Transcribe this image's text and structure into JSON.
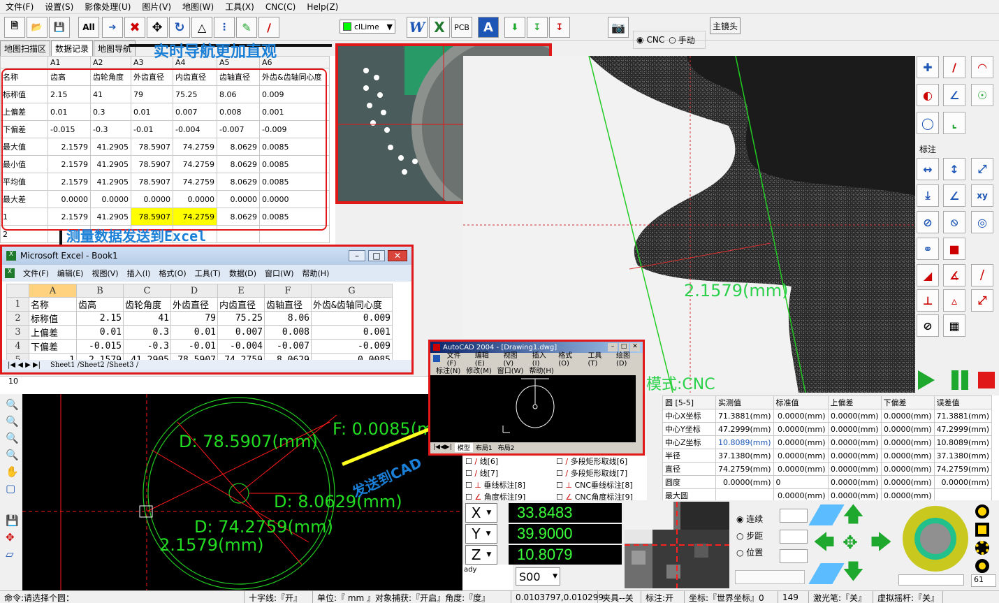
{
  "menu": [
    "文件(F)",
    "设置(S)",
    "影像处理(U)",
    "图片(V)",
    "地图(W)",
    "工具(X)",
    "CNC(C)",
    "Help(Z)"
  ],
  "toolbar": {
    "all_label": "All",
    "color_value": "clLime",
    "pcb_label": "PCB",
    "mode_cnc": "CNC",
    "mode_manual": "手动",
    "main_lens": "主镜头"
  },
  "tabs": [
    "地图扫描区",
    "数据记录",
    "地图导航"
  ],
  "ann": {
    "nav": "实时导航更加直观",
    "excel": "测量数据发送到Excel",
    "cad": "发送到CAD",
    "mode": "模式:CNC",
    "meas": "2.1579(mm)"
  },
  "grid": {
    "cols": [
      "",
      "A1",
      "A2",
      "A3",
      "A4",
      "A5",
      "A6"
    ],
    "rows": [
      [
        "名称",
        "齿高",
        "齿轮角度",
        "外齿直径",
        "内齿直径",
        "齿轴直径",
        "外齿&齿轴同心度"
      ],
      [
        "标称值",
        "2.15",
        "41",
        "79",
        "75.25",
        "8.06",
        "0.009"
      ],
      [
        "上偏差",
        "0.01",
        "0.3",
        "0.01",
        "0.007",
        "0.008",
        "0.001"
      ],
      [
        "下偏差",
        "-0.015",
        "-0.3",
        "-0.01",
        "-0.004",
        "-0.007",
        "-0.009"
      ],
      [
        "最大值",
        "2.1579",
        "41.2905",
        "78.5907",
        "74.2759",
        "8.0629",
        "0.0085"
      ],
      [
        "最小值",
        "2.1579",
        "41.2905",
        "78.5907",
        "74.2759",
        "8.0629",
        "0.0085"
      ],
      [
        "平均值",
        "2.1579",
        "41.2905",
        "78.5907",
        "74.2759",
        "8.0629",
        "0.0085"
      ],
      [
        "最大差",
        "0.0000",
        "0.0000",
        "0.0000",
        "0.0000",
        "0.0000",
        "0.0000"
      ],
      [
        "1",
        "2.1579",
        "41.2905",
        "78.5907",
        "74.2759",
        "8.0629",
        "0.0085"
      ],
      [
        "2",
        "",
        "",
        "",
        "",
        "",
        ""
      ]
    ]
  },
  "excel": {
    "title": "Microsoft Excel - Book1",
    "menu": [
      "文件(F)",
      "编辑(E)",
      "视图(V)",
      "插入(I)",
      "格式(O)",
      "工具(T)",
      "数据(D)",
      "窗口(W)",
      "帮助(H)"
    ],
    "cols": [
      "A",
      "B",
      "C",
      "D",
      "E",
      "F",
      "G"
    ],
    "rows": [
      [
        "名称",
        "齿高",
        "齿轮角度",
        "外齿直径",
        "内齿直径",
        "齿轴直径",
        "外齿&齿轴同心度"
      ],
      [
        "标称值",
        "2.15",
        "41",
        "79",
        "75.25",
        "8.06",
        "0.009"
      ],
      [
        "上偏差",
        "0.01",
        "0.3",
        "0.01",
        "0.007",
        "0.008",
        "0.001"
      ],
      [
        "下偏差",
        "-0.015",
        "-0.3",
        "-0.01",
        "-0.004",
        "-0.007",
        "-0.009"
      ],
      [
        "1",
        "2.1579",
        "41.2905",
        "78.5907",
        "74.2759",
        "8.0629",
        "0.0085"
      ]
    ],
    "sheets": "Sheet1 /Sheet2 /Sheet3 /",
    "row10": "10"
  },
  "cad": {
    "title": "AutoCAD 2004 - [Drawing1.dwg]",
    "menu1": [
      "文件(F)",
      "编辑(E)",
      "视图(V)",
      "插入(I)",
      "格式(O)",
      "工具(T)",
      "绘图(D)"
    ],
    "menu2": [
      "标注(N)",
      "修改(M)",
      "窗口(W)",
      "帮助(H)"
    ],
    "tabs": [
      "模型",
      "布局1",
      "布局2"
    ]
  },
  "drawing": {
    "d1": "D: 78.5907(mm)",
    "f": "F: 0.0085(m",
    "d2": "D: 8.0629(mm)",
    "d3": "D: 74.2759(mm)",
    "h": "2.1579(mm)"
  },
  "rpanel": {
    "section": "标注"
  },
  "results": {
    "header": [
      "圆 [5-5]",
      "实测值",
      "标准值",
      "上偏差",
      "下偏差",
      "误差值"
    ],
    "rows": [
      [
        "中心X坐标",
        "71.3881(mm)",
        "0.0000(mm)",
        "0.0000(mm)",
        "0.0000(mm)",
        "71.3881(mm)"
      ],
      [
        "中心Y坐标",
        "47.2999(mm)",
        "0.0000(mm)",
        "0.0000(mm)",
        "0.0000(mm)",
        "47.2999(mm)"
      ],
      [
        "中心Z坐标",
        "10.8089(mm)",
        "0.0000(mm)",
        "0.0000(mm)",
        "0.0000(mm)",
        "10.8089(mm)"
      ],
      [
        "半径",
        "37.1380(mm)",
        "0.0000(mm)",
        "0.0000(mm)",
        "0.0000(mm)",
        "37.1380(mm)"
      ],
      [
        "直径",
        "74.2759(mm)",
        "0.0000(mm)",
        "0.0000(mm)",
        "0.0000(mm)",
        "74.2759(mm)"
      ],
      [
        "圆度",
        "0.0000(mm)",
        "0",
        "0.0000(mm)",
        "0.0000(mm)",
        "0.0000(mm)"
      ],
      [
        "最大圆",
        "",
        "0.0000(mm)",
        "0.0000(mm)",
        "0.0000(mm)",
        ""
      ]
    ]
  },
  "tools": {
    "left": [
      "线[6]",
      "线[7]",
      "垂线标注[8]",
      "角度标注[9]"
    ],
    "right": [
      "多段矩形取线[6]",
      "多段矩形取线[7]",
      "CNC垂线标注[8]",
      "CNC角度标注[9]"
    ]
  },
  "dro": {
    "x_label": "X",
    "y_label": "Y",
    "z_label": "Z",
    "x": "33.8483",
    "y": "39.9000",
    "z": "10.8079",
    "log": "ady",
    "speed": "S00"
  },
  "motion": {
    "continuous": "连续",
    "step": "步距",
    "position": "位置",
    "zoom": "61"
  },
  "status": [
    "命令:请选择个圆：",
    "十字线:『开』",
    "单位:『 mm 』对象捕获:『开启』角度:『度』",
    "0.0103797,0.010299",
    "夹具--关",
    "标注:开",
    "坐标:『世界坐标』0",
    "149",
    "激光笔:『关』",
    "虚拟摇杆:『关』"
  ]
}
